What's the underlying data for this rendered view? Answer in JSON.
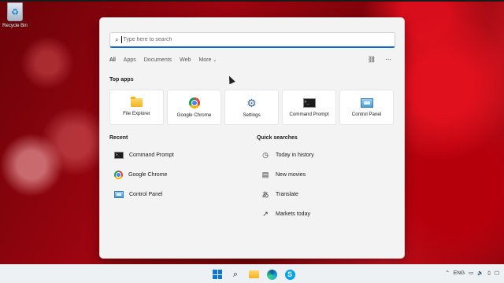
{
  "desktop": {
    "recycle_bin_label": "Recycle Bin"
  },
  "search": {
    "placeholder": "Type here to search"
  },
  "filters": {
    "tabs": [
      "All",
      "Apps",
      "Documents",
      "Web",
      "More"
    ],
    "active": "All"
  },
  "top_apps": {
    "title": "Top apps",
    "items": [
      {
        "label": "File Explorer",
        "icon": "folder-icon"
      },
      {
        "label": "Google Chrome",
        "icon": "chrome-icon"
      },
      {
        "label": "Settings",
        "icon": "gear-icon"
      },
      {
        "label": "Command Prompt",
        "icon": "terminal-icon"
      },
      {
        "label": "Control Panel",
        "icon": "control-panel-icon"
      }
    ]
  },
  "recent": {
    "title": "Recent",
    "items": [
      {
        "label": "Command Prompt",
        "icon": "terminal-icon"
      },
      {
        "label": "Google Chrome",
        "icon": "chrome-icon"
      },
      {
        "label": "Control Panel",
        "icon": "control-panel-icon"
      }
    ]
  },
  "quick_searches": {
    "title": "Quick searches",
    "items": [
      {
        "label": "Today in history",
        "icon": "clock-icon"
      },
      {
        "label": "New movies",
        "icon": "film-icon"
      },
      {
        "label": "Translate",
        "icon": "translate-icon"
      },
      {
        "label": "Markets today",
        "icon": "chart-icon"
      }
    ]
  },
  "taskbar": {
    "language": "ENG"
  },
  "colors": {
    "accent": "#0b6bc8",
    "panel_bg": "#f3f3f3"
  }
}
